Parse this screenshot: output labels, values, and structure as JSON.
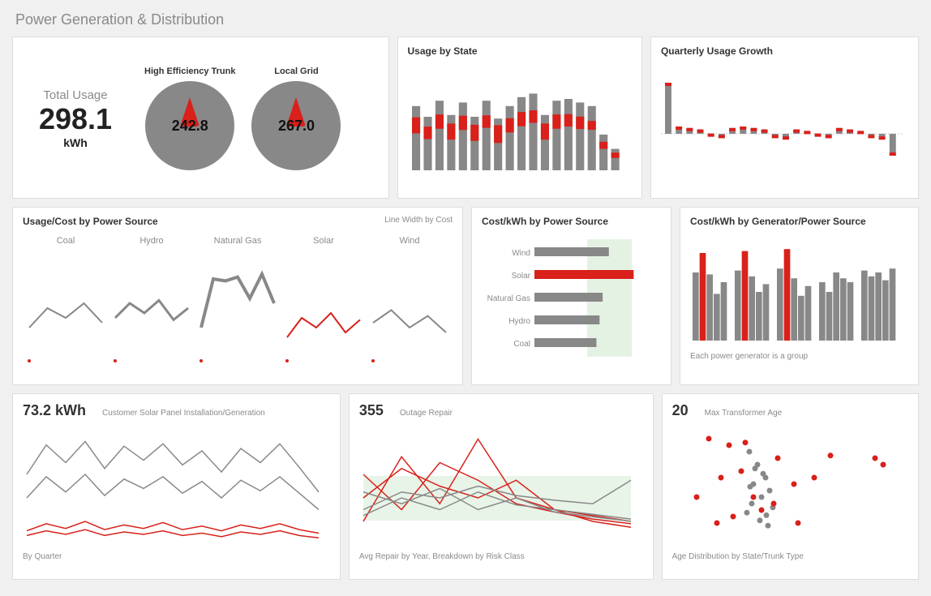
{
  "title": "Power Generation & Distribution",
  "row1": {
    "total": {
      "label": "Total Usage",
      "value": "298.1",
      "unit": "kWh"
    },
    "gauges": [
      {
        "label": "High Efficiency Trunk",
        "value": "242.8"
      },
      {
        "label": "Local Grid",
        "value": "267.0"
      }
    ],
    "usage_state": {
      "title": "Usage by State"
    },
    "growth": {
      "title": "Quarterly Usage Growth"
    }
  },
  "row2": {
    "usage_cost": {
      "title": "Usage/Cost by Power Source",
      "sub": "Line Width by Cost",
      "cats": [
        "Coal",
        "Hydro",
        "Natural Gas",
        "Solar",
        "Wind"
      ]
    },
    "cost_kwh": {
      "title": "Cost/kWh by Power Source",
      "labels": [
        "Wind",
        "Solar",
        "Natural Gas",
        "Hydro",
        "Coal"
      ]
    },
    "gen": {
      "title": "Cost/kWh by Generator/Power Source",
      "foot": "Each power generator is a group"
    }
  },
  "row3": {
    "solar": {
      "value": "73.2 kWh",
      "title": "Customer Solar Panel Installation/Generation",
      "foot": "By Quarter"
    },
    "outage": {
      "value": "355",
      "title": "Outage Repair",
      "foot": "Avg Repair by Year, Breakdown by Risk Class"
    },
    "age": {
      "value": "20",
      "title": "Max Transformer Age",
      "foot": "Age Distribution by State/Trunk Type"
    }
  },
  "chart_data": {
    "gauges": [
      {
        "name": "High Efficiency Trunk",
        "value": 242.8
      },
      {
        "name": "Local Grid",
        "value": 267.0
      }
    ],
    "usage_by_state": {
      "type": "bar",
      "series": [
        {
          "name": "base",
          "values": [
            72,
            60,
            78,
            62,
            76,
            60,
            78,
            58,
            72,
            82,
            86,
            62,
            78,
            80,
            76,
            72,
            40,
            24
          ]
        },
        {
          "name": "overlay",
          "values": [
            18,
            14,
            16,
            18,
            16,
            18,
            14,
            20,
            16,
            16,
            14,
            18,
            16,
            14,
            14,
            10,
            8,
            6
          ]
        }
      ]
    },
    "quarterly_growth": {
      "type": "bar",
      "series": [
        {
          "name": "q",
          "values": [
            70,
            10,
            8,
            6,
            -4,
            -6,
            8,
            10,
            8,
            6,
            -6,
            -8,
            6,
            4,
            -4,
            -6,
            8,
            6,
            4,
            -6,
            -8,
            -30
          ]
        }
      ]
    },
    "usage_cost_sparklines": {
      "type": "line",
      "Coal": [
        30,
        50,
        40,
        55,
        35
      ],
      "Hydro": [
        40,
        55,
        45,
        58,
        38,
        50
      ],
      "Natural Gas": [
        30,
        80,
        78,
        82,
        60,
        85,
        55
      ],
      "Solar": [
        20,
        40,
        30,
        45,
        25,
        38
      ],
      "Wind": [
        35,
        48,
        30,
        42,
        25
      ]
    },
    "cost_kwh_by_source": {
      "type": "bar",
      "categories": [
        "Wind",
        "Solar",
        "Natural Gas",
        "Hydro",
        "Coal"
      ],
      "values": [
        120,
        160,
        110,
        105,
        100
      ]
    },
    "cost_kwh_by_generator": {
      "type": "bar",
      "groups": 5,
      "per_group": 5,
      "values": [
        [
          70,
          90,
          68,
          48,
          60
        ],
        [
          72,
          92,
          66,
          50,
          58
        ],
        [
          74,
          94,
          64,
          46,
          56
        ],
        [
          60,
          50,
          70,
          64,
          60
        ],
        [
          72,
          66,
          70,
          62,
          74
        ]
      ],
      "highlight_index": 1
    },
    "customer_solar": {
      "type": "line",
      "series": [
        {
          "name": "a",
          "values": [
            60,
            85,
            70,
            88,
            65,
            84,
            72,
            86,
            68,
            80,
            62,
            82,
            70,
            86,
            66,
            45
          ]
        },
        {
          "name": "b",
          "values": [
            40,
            58,
            45,
            60,
            42,
            56,
            48,
            58,
            44,
            54,
            40,
            55,
            46,
            58,
            44,
            30
          ]
        },
        {
          "name": "c",
          "values": [
            12,
            18,
            14,
            20,
            13,
            17,
            14,
            19,
            13,
            16,
            12,
            17,
            14,
            18,
            13,
            10
          ]
        },
        {
          "name": "d",
          "values": [
            8,
            12,
            9,
            13,
            8,
            11,
            9,
            12,
            8,
            10,
            7,
            11,
            9,
            12,
            8,
            6
          ]
        }
      ]
    },
    "outage_repair": {
      "type": "line",
      "series": [
        {
          "name": "r1",
          "values": [
            20,
            75,
            35,
            90,
            40,
            30,
            25,
            20
          ]
        },
        {
          "name": "r2",
          "values": [
            60,
            30,
            70,
            55,
            35,
            28,
            22,
            18
          ]
        },
        {
          "name": "r3",
          "values": [
            40,
            65,
            50,
            40,
            55,
            30,
            20,
            15
          ]
        },
        {
          "name": "g1",
          "values": [
            30,
            45,
            40,
            50,
            42,
            38,
            35,
            55
          ]
        },
        {
          "name": "g2",
          "values": [
            45,
            35,
            48,
            30,
            40,
            28,
            24,
            20
          ]
        },
        {
          "name": "g3",
          "values": [
            25,
            40,
            30,
            45,
            34,
            30,
            26,
            22
          ]
        }
      ]
    },
    "transformer_age": {
      "type": "scatter",
      "red": [
        [
          45,
          85
        ],
        [
          70,
          80
        ],
        [
          90,
          82
        ],
        [
          110,
          30
        ],
        [
          60,
          55
        ],
        [
          85,
          60
        ],
        [
          130,
          70
        ],
        [
          150,
          50
        ],
        [
          30,
          40
        ],
        [
          55,
          20
        ],
        [
          75,
          25
        ],
        [
          100,
          40
        ],
        [
          125,
          35
        ],
        [
          155,
          20
        ],
        [
          175,
          55
        ],
        [
          195,
          72
        ],
        [
          250,
          70
        ],
        [
          260,
          65
        ]
      ],
      "gray": [
        [
          95,
          75
        ],
        [
          105,
          65
        ],
        [
          115,
          55
        ],
        [
          100,
          50
        ],
        [
          120,
          45
        ],
        [
          110,
          40
        ],
        [
          98,
          35
        ],
        [
          92,
          28
        ],
        [
          108,
          22
        ],
        [
          118,
          18
        ],
        [
          102,
          62
        ],
        [
          112,
          58
        ],
        [
          96,
          48
        ],
        [
          124,
          32
        ],
        [
          116,
          26
        ]
      ]
    }
  }
}
